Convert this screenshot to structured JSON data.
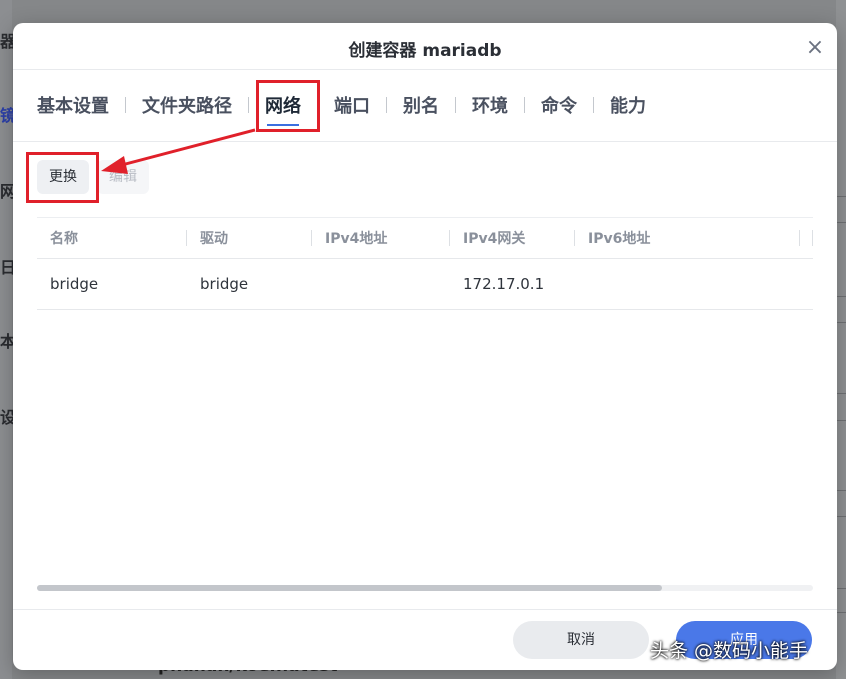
{
  "background": {
    "left_chars": [
      "器",
      "镜",
      "网",
      "日",
      "本",
      "设"
    ],
    "bottom_text": "phanan/koel:latest"
  },
  "dialog": {
    "title": "创建容器 mariadb",
    "close_symbol": "×"
  },
  "tabs": [
    {
      "label": "基本设置",
      "active": false
    },
    {
      "label": "文件夹路径",
      "active": false
    },
    {
      "label": "网络",
      "active": true
    },
    {
      "label": "端口",
      "active": false
    },
    {
      "label": "别名",
      "active": false
    },
    {
      "label": "环境",
      "active": false
    },
    {
      "label": "命令",
      "active": false
    },
    {
      "label": "能力",
      "active": false
    }
  ],
  "toolbar": {
    "change_label": "更换",
    "edit_label": "编辑"
  },
  "table": {
    "headers": [
      "名称",
      "驱动",
      "IPv4地址",
      "IPv4网关",
      "IPv6地址"
    ],
    "rows": [
      [
        "bridge",
        "bridge",
        "",
        "172.17.0.1",
        ""
      ]
    ]
  },
  "footer": {
    "cancel_label": "取消",
    "apply_label": "应用"
  },
  "watermark": "头条 @数码小能手",
  "colors": {
    "accent": "#4a78e8",
    "tab_underline": "#3b6fe0",
    "annotation_red": "#e0202a"
  }
}
